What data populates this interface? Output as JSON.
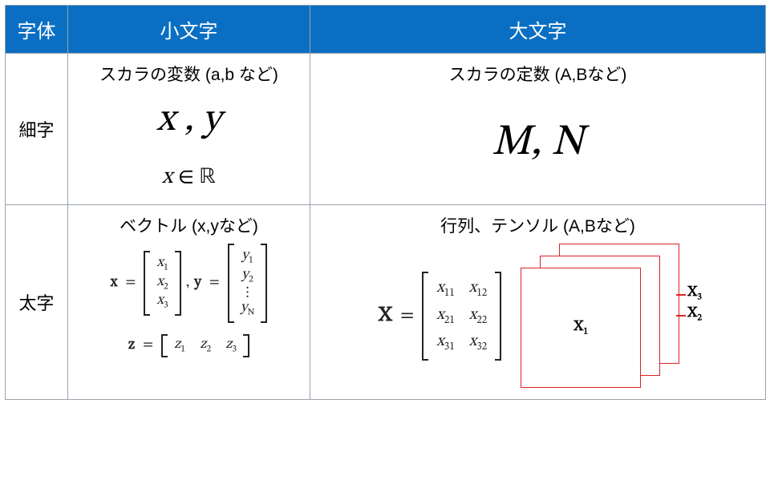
{
  "header": {
    "col0": "字体",
    "col1": "小文字",
    "col2": "大文字"
  },
  "rowHeaders": {
    "thin": "細字",
    "bold": "太字"
  },
  "cells": {
    "thinLower": {
      "title": "スカラの変数 (a,b など)",
      "expr_xy": "x ,  y",
      "expr_xR_lhs": "x",
      "expr_xR_in": " ∈ ",
      "expr_xR_rhs": "ℝ"
    },
    "thinUpper": {
      "title": "スカラの定数 (A,Bなど)",
      "expr_MN": "M,  N"
    },
    "boldLower": {
      "title": "ベクトル (x,yなど)",
      "x_label": "x",
      "x_entries": [
        "x",
        "x",
        "x"
      ],
      "x_subs": [
        "1",
        "2",
        "3"
      ],
      "y_label": "y",
      "y_entries": [
        "y",
        "y",
        "⋮",
        "y"
      ],
      "y_subs": [
        "1",
        "2",
        "",
        "N"
      ],
      "z_label": "z",
      "z_entries": [
        "z",
        "z",
        "z"
      ],
      "z_subs": [
        "1",
        "2",
        "3"
      ]
    },
    "boldUpper": {
      "title": "行列、テンソル (A,Bなど)",
      "X_label": "X",
      "X_entries": [
        "x",
        "x",
        "x",
        "x",
        "x",
        "x"
      ],
      "X_subs": [
        "11",
        "12",
        "21",
        "22",
        "31",
        "32"
      ],
      "tensor_labels": {
        "front": "X",
        "front_sub": "1",
        "mid": "X",
        "mid_sub": "2",
        "back": "X",
        "back_sub": "3"
      }
    }
  },
  "eq": "=",
  "comma": ","
}
